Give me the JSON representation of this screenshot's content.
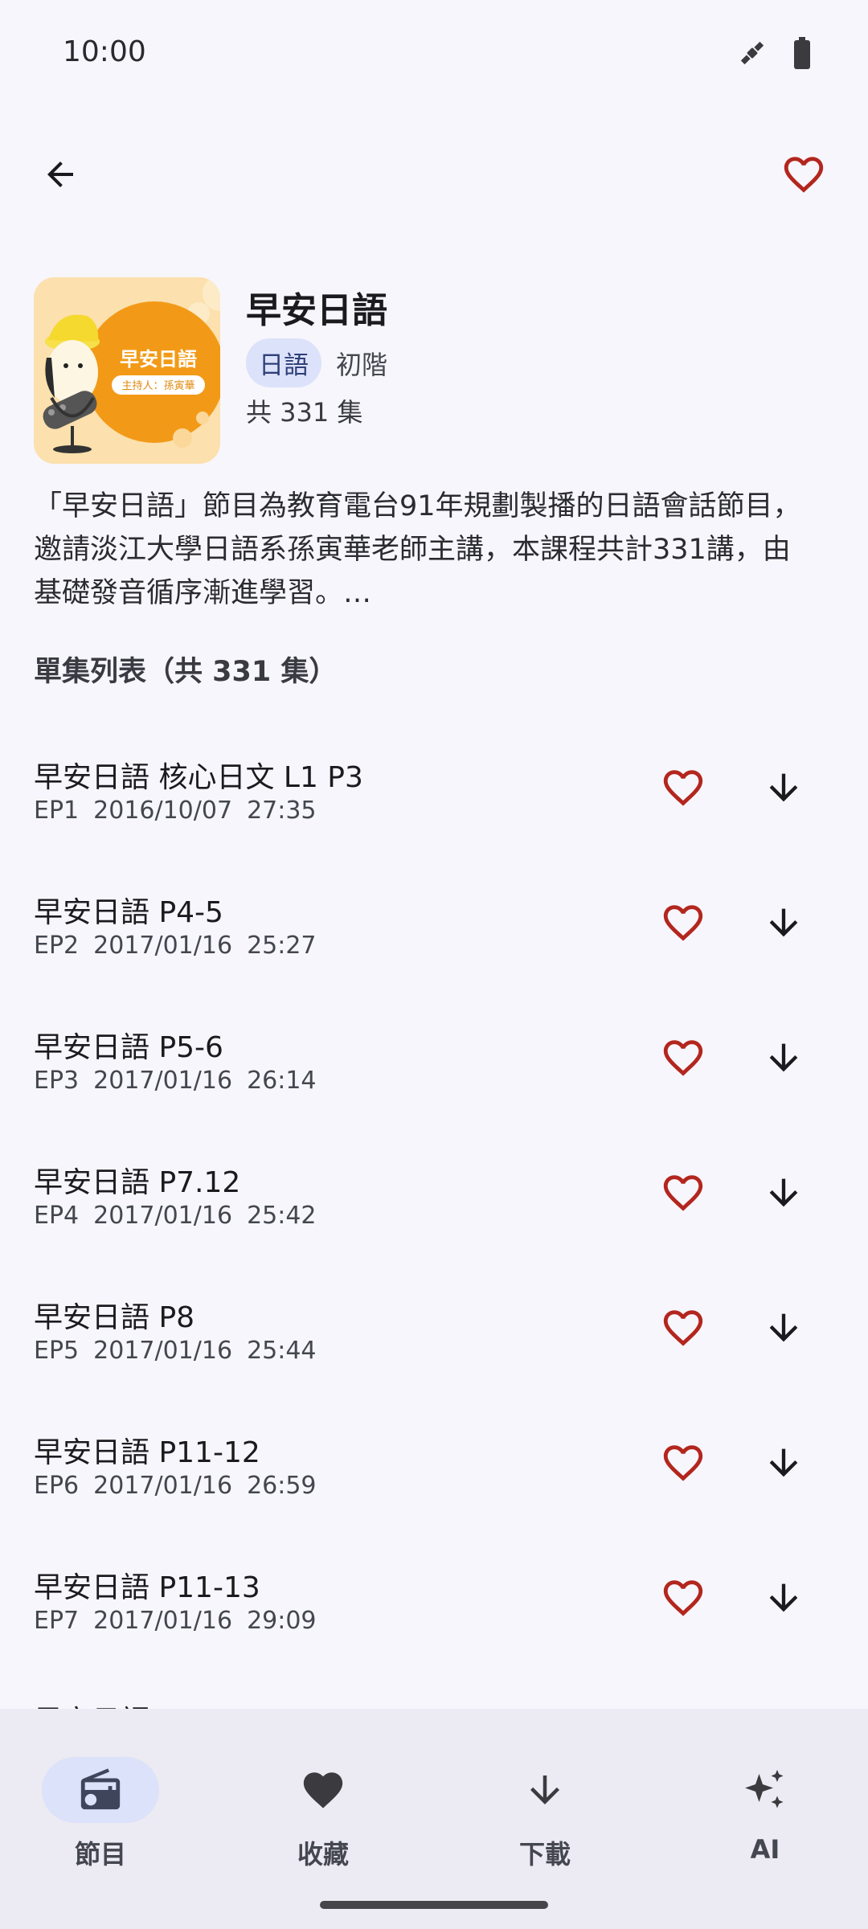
{
  "status": {
    "time": "10:00"
  },
  "podcast": {
    "title": "早安日語",
    "tag": "日語",
    "level": "初階",
    "count_text": "共 331 集",
    "cover_title": "早安日語",
    "cover_host": "主持人：孫寅華",
    "description_line1": "「早安日語」節目為教育電台91年規劃製播的日語會話節目，",
    "description_line2": "邀請淡江大學日語系孫寅華老師主講，本課程共計331講，由",
    "description_line3": "基礎發音循序漸進學習。…"
  },
  "section_title": "單集列表（共 331 集）",
  "episodes": [
    {
      "title": "早安日語 核心日文 L1 P3",
      "ep": "EP1",
      "date": "2016/10/07",
      "duration": "27:35"
    },
    {
      "title": "早安日語 P4-5",
      "ep": "EP2",
      "date": "2017/01/16",
      "duration": "25:27"
    },
    {
      "title": "早安日語 P5-6",
      "ep": "EP3",
      "date": "2017/01/16",
      "duration": "26:14"
    },
    {
      "title": "早安日語 P7.12",
      "ep": "EP4",
      "date": "2017/01/16",
      "duration": "25:42"
    },
    {
      "title": "早安日語 P8",
      "ep": "EP5",
      "date": "2017/01/16",
      "duration": "25:44"
    },
    {
      "title": "早安日語 P11-12",
      "ep": "EP6",
      "date": "2017/01/16",
      "duration": "26:59"
    },
    {
      "title": "早安日語 P11-13",
      "ep": "EP7",
      "date": "2017/01/16",
      "duration": "29:09"
    }
  ],
  "partial_episode_title": "早安日語",
  "nav": {
    "items": [
      {
        "label": "節目",
        "icon": "radio-icon",
        "active": true
      },
      {
        "label": "收藏",
        "icon": "heart-icon",
        "active": false
      },
      {
        "label": "下載",
        "icon": "download-icon",
        "active": false
      },
      {
        "label": "AI",
        "icon": "sparkles-icon",
        "active": false
      }
    ]
  },
  "colors": {
    "accent_heart": "#b3261e",
    "chip_bg": "#dce2f9",
    "background": "#f7f6fc",
    "nav_bg": "#eceaf2"
  }
}
